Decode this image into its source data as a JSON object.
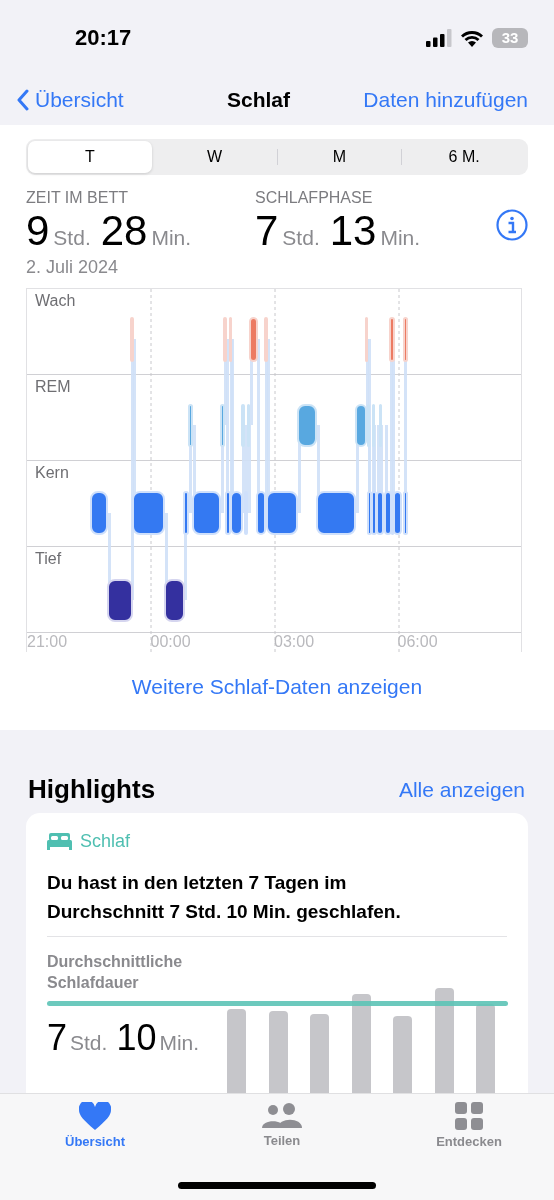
{
  "status_bar": {
    "time": "20:17",
    "battery": "33"
  },
  "nav": {
    "back": "Übersicht",
    "title": "Schlaf",
    "action": "Daten hinzufügen"
  },
  "ranges": [
    {
      "label": "T",
      "selected": true
    },
    {
      "label": "W",
      "selected": false
    },
    {
      "label": "M",
      "selected": false
    },
    {
      "label": "6 M.",
      "selected": false
    }
  ],
  "stats": [
    {
      "label": "ZEIT IM BETT",
      "parts": [
        {
          "value": "9",
          "unit": "Std."
        },
        {
          "value": "28",
          "unit": "Min."
        }
      ]
    },
    {
      "label": "SCHLAFPHASE",
      "parts": [
        {
          "value": "7",
          "unit": "Std."
        },
        {
          "value": "13",
          "unit": "Min."
        }
      ]
    }
  ],
  "date": "2. Juli 2024",
  "sleep_chart": {
    "stages": [
      "Wach",
      "REM",
      "Kern",
      "Tief"
    ],
    "time_labels": [
      "21:00",
      "00:00",
      "03:00",
      "06:00"
    ]
  },
  "more_link": "Weitere Schlaf-Daten anzeigen",
  "highlights": {
    "title": "Highlights",
    "action": "Alle anzeigen",
    "card": {
      "category": "Schlaf",
      "text": "Du hast in den letzten 7 Tagen im Durchschnitt 7 Std. 10 Min. geschlafen.",
      "metric_label": "Durchschnittliche Schlafdauer",
      "metric": [
        {
          "value": "7",
          "unit": "Std."
        },
        {
          "value": "10",
          "unit": "Min."
        }
      ]
    }
  },
  "tab_bar": [
    {
      "label": "Übersicht",
      "selected": true
    },
    {
      "label": "Teilen",
      "selected": false
    },
    {
      "label": "Entdecken",
      "selected": false
    }
  ]
}
